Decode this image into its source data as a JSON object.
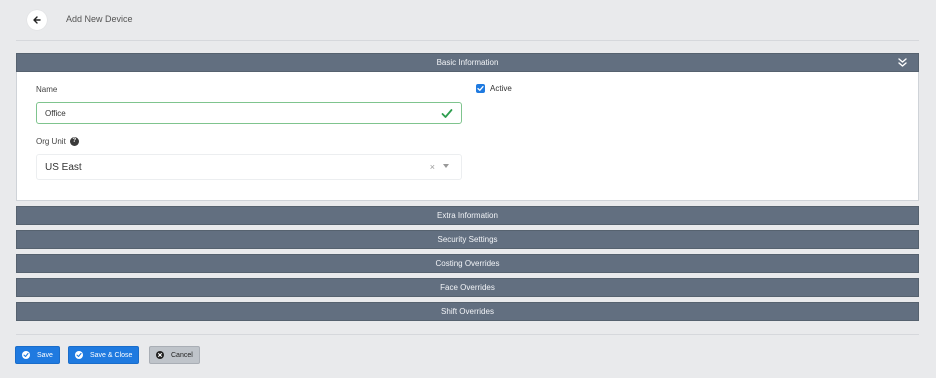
{
  "header": {
    "back_icon": "arrow-left-icon",
    "title": "Add New Device"
  },
  "sections": {
    "basic": {
      "title": "Basic Information",
      "icon": "double-chevron-down-icon"
    },
    "extra": {
      "title": "Extra Information"
    },
    "security": {
      "title": "Security Settings"
    },
    "costing": {
      "title": "Costing Overrides"
    },
    "face": {
      "title": "Face Overrides"
    },
    "shift": {
      "title": "Shift Overrides"
    }
  },
  "form": {
    "name_label": "Name",
    "name_value": "Office",
    "org_unit_label": "Org Unit",
    "org_unit_value": "US East",
    "clear_glyph": "×",
    "active_label": "Active",
    "active_checked": true
  },
  "buttons": {
    "save": "Save",
    "save_close": "Save & Close",
    "cancel": "Cancel"
  },
  "colors": {
    "header_bg": "#626f80",
    "primary": "#1f7ae0",
    "valid_border": "#7fc48e",
    "valid_check": "#2e9e4f",
    "page_bg": "#e9eaec"
  }
}
